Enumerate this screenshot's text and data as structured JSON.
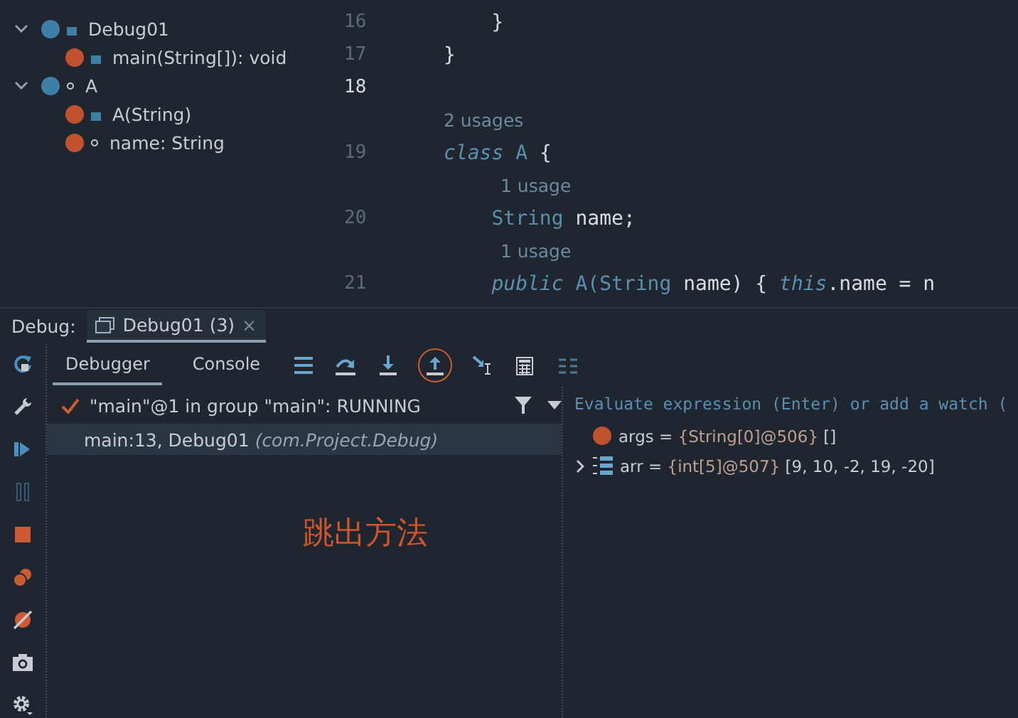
{
  "structure": {
    "items": [
      {
        "label": "Debug01",
        "kind": "public-class",
        "expanded": true,
        "children": [
          {
            "label": "main(String[]): void",
            "kind": "public-method"
          }
        ]
      },
      {
        "label": "A",
        "kind": "package-class",
        "expanded": true,
        "children": [
          {
            "label": "A(String)",
            "kind": "public-method"
          },
          {
            "label": "name: String",
            "kind": "package-field"
          }
        ]
      }
    ]
  },
  "editor": {
    "lines": [
      {
        "kind": "code",
        "number": "16",
        "current": false,
        "tokens": [
          {
            "kind": "plain",
            "text": "    }"
          }
        ]
      },
      {
        "kind": "code",
        "number": "17",
        "current": false,
        "tokens": [
          {
            "kind": "plain",
            "text": "}"
          }
        ]
      },
      {
        "kind": "code",
        "number": "18",
        "current": true
      },
      {
        "kind": "hint",
        "text": "2 usages",
        "indent": false
      },
      {
        "kind": "code",
        "number": "19",
        "current": false,
        "tokens": [
          {
            "kind": "keyword",
            "text": "class"
          },
          {
            "kind": "type",
            "text": " A "
          },
          {
            "kind": "plain",
            "text": "{"
          }
        ]
      },
      {
        "kind": "hint",
        "text": "1 usage",
        "indent": true
      },
      {
        "kind": "code",
        "number": "20",
        "current": false,
        "tokens": [
          {
            "kind": "type",
            "text": "    String"
          },
          {
            "kind": "plain",
            "text": " name;"
          }
        ]
      },
      {
        "kind": "hint",
        "text": "1 usage",
        "indent": true
      },
      {
        "kind": "code",
        "number": "21",
        "current": false,
        "tokens": [
          {
            "kind": "keyword",
            "text": "    public"
          },
          {
            "kind": "type",
            "text": " A(String"
          },
          {
            "kind": "plain",
            "text": " name) { "
          },
          {
            "kind": "keyword",
            "text": "this"
          },
          {
            "kind": "plain",
            "text": ".name = n"
          }
        ]
      }
    ]
  },
  "debug": {
    "label": "Debug:",
    "tab": {
      "title": "Debug01 (3)",
      "close": "×",
      "selected": true
    },
    "tabs": [
      {
        "label": "Debugger",
        "selected": true
      },
      {
        "label": "Console",
        "selected": false
      }
    ],
    "tools": [
      {
        "kind": "frames",
        "highlighted": false
      },
      {
        "kind": "step-over",
        "highlighted": false
      },
      {
        "kind": "step-into",
        "highlighted": false
      },
      {
        "kind": "step-out",
        "highlighted": true
      },
      {
        "kind": "run-to-cursor",
        "highlighted": false
      },
      {
        "kind": "evaluate",
        "highlighted": false
      },
      {
        "kind": "trace",
        "highlighted": false
      }
    ],
    "side_tools": [
      {
        "kind": "rerun",
        "disabled": false
      },
      {
        "kind": "settings",
        "disabled": false
      },
      {
        "kind": "resume",
        "disabled": false
      },
      {
        "kind": "pause",
        "disabled": true
      },
      {
        "kind": "stop",
        "disabled": false
      },
      {
        "kind": "breakpoints",
        "disabled": false
      },
      {
        "kind": "mute",
        "disabled": false
      },
      {
        "kind": "camera",
        "disabled": false
      },
      {
        "kind": "gear",
        "disabled": false
      }
    ],
    "thread": "\"main\"@1 in group \"main\": RUNNING",
    "frames": [
      {
        "method": "main:13, Debug01",
        "location": "(com.Project.Debug)",
        "selected": true
      }
    ],
    "annotation": "跳出方法",
    "evaluate_placeholder": "Evaluate expression (Enter) or add a watch (",
    "variables": [
      {
        "kind": "param",
        "expandable": false,
        "name": "args =",
        "type": "{String[0]@506}",
        "value": "[]"
      },
      {
        "kind": "array",
        "expandable": true,
        "name": "arr =",
        "type": "{int[5]@507}",
        "value": "[9, 10, -2, 19, -20]"
      }
    ]
  }
}
